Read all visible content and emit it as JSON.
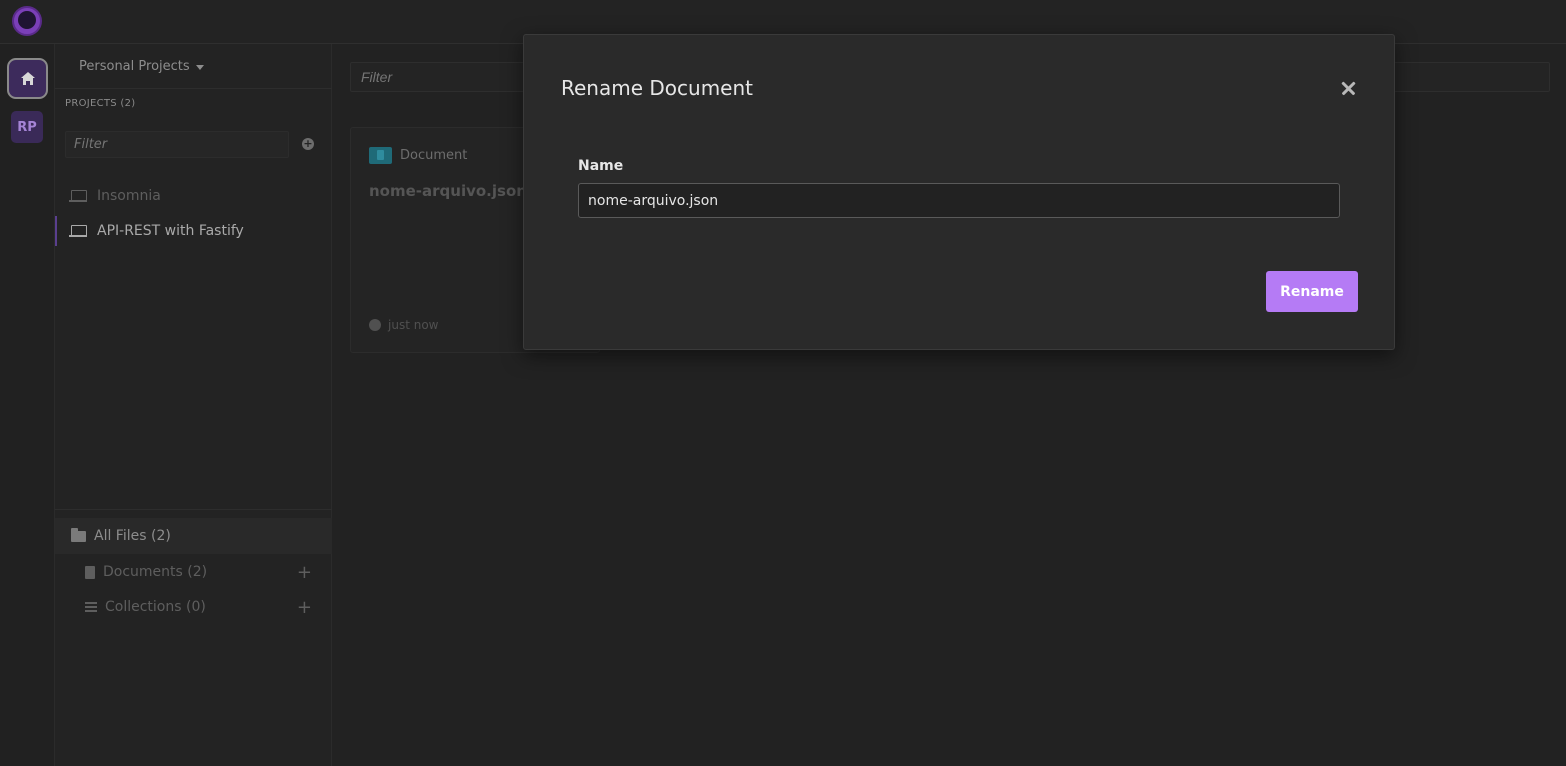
{
  "org": {
    "dropdown_label": "Personal Projects",
    "badge": "RP"
  },
  "projects": {
    "header": "PROJECTS (2)",
    "filter_placeholder": "Filter",
    "items": [
      {
        "label": "Insomnia"
      },
      {
        "label": "API-REST with Fastify"
      }
    ]
  },
  "files": {
    "all": "All Files (2)",
    "documents": "Documents (2)",
    "collections": "Collections (0)"
  },
  "main": {
    "filter_placeholder": "Filter",
    "card": {
      "type": "Document",
      "title": "nome-arquivo.json",
      "time": "just now"
    }
  },
  "modal": {
    "title": "Rename Document",
    "field_label": "Name",
    "field_value": "nome-arquivo.json",
    "submit_label": "Rename"
  },
  "colors": {
    "accent": "#b57bf5",
    "background": "#222222"
  }
}
